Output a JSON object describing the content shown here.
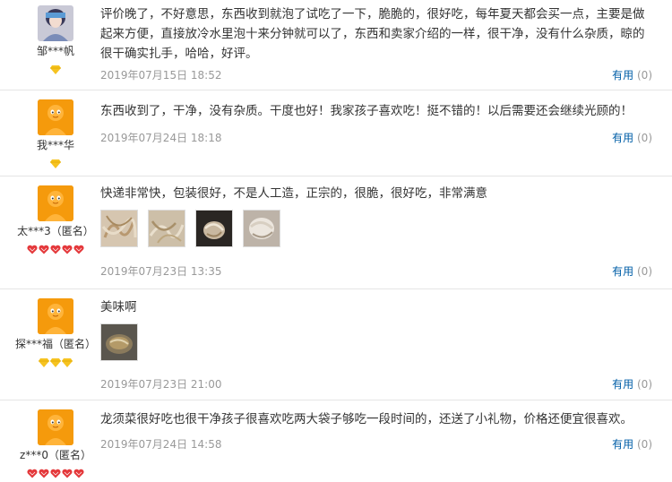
{
  "reviews": [
    {
      "username": "邹***帆",
      "avatar_icon": "user-photo-avatar",
      "level_icon": "yellow-diamond-icon",
      "level_count": 1,
      "text": "评价晚了，不好意思，东西收到就泡了试吃了一下，脆脆的，很好吃，每年夏天都会买一点，主要是做起来方便，直接放冷水里泡十来分钟就可以了，东西和卖家介绍的一样，很干净，没有什么杂质，晾的很干确实扎手，哈哈，好评。",
      "date": "2019年07月15日 18:52",
      "useful_label": "有用",
      "useful_count": "(0)"
    },
    {
      "username": "我***华",
      "avatar_icon": "default-avatar",
      "level_icon": "yellow-diamond-icon",
      "level_count": 1,
      "text": "东西收到了，干净，没有杂质。干度也好！我家孩子喜欢吃！挺不错的！以后需要还会继续光顾的！",
      "date": "2019年07月24日 18:18",
      "useful_label": "有用",
      "useful_count": "(0)"
    },
    {
      "username": "太***3（匿名）",
      "avatar_icon": "default-avatar",
      "level_icon": "red-heart-icon",
      "level_count": 5,
      "text": "快递非常快，包装很好，不是人工造，正宗的，很脆，很好吃，非常满意",
      "images": [
        "photo-1",
        "photo-2",
        "photo-3",
        "photo-4"
      ],
      "date": "2019年07月23日 13:35",
      "useful_label": "有用",
      "useful_count": "(0)"
    },
    {
      "username": "探***福（匿名）",
      "avatar_icon": "default-avatar",
      "level_icon": "yellow-diamond-icon",
      "level_count": 3,
      "text": "美味啊",
      "images": [
        "photo-1"
      ],
      "date": "2019年07月23日 21:00",
      "useful_label": "有用",
      "useful_count": "(0)"
    },
    {
      "username": "z***0（匿名）",
      "avatar_icon": "default-avatar",
      "level_icon": "red-heart-icon",
      "level_count": 5,
      "text": "龙须菜很好吃也很干净孩子很喜欢吃两大袋子够吃一段时间的，还送了小礼物，价格还便宜很喜欢。",
      "date": "2019年07月24日 14:58",
      "useful_label": "有用",
      "useful_count": "(0)"
    }
  ],
  "colors": {
    "link": "#005ea7",
    "meta": "#999999",
    "avatar_orange": "#f59a0c",
    "diamond_yellow": "#f6c321",
    "heart_red": "#e4393c"
  }
}
